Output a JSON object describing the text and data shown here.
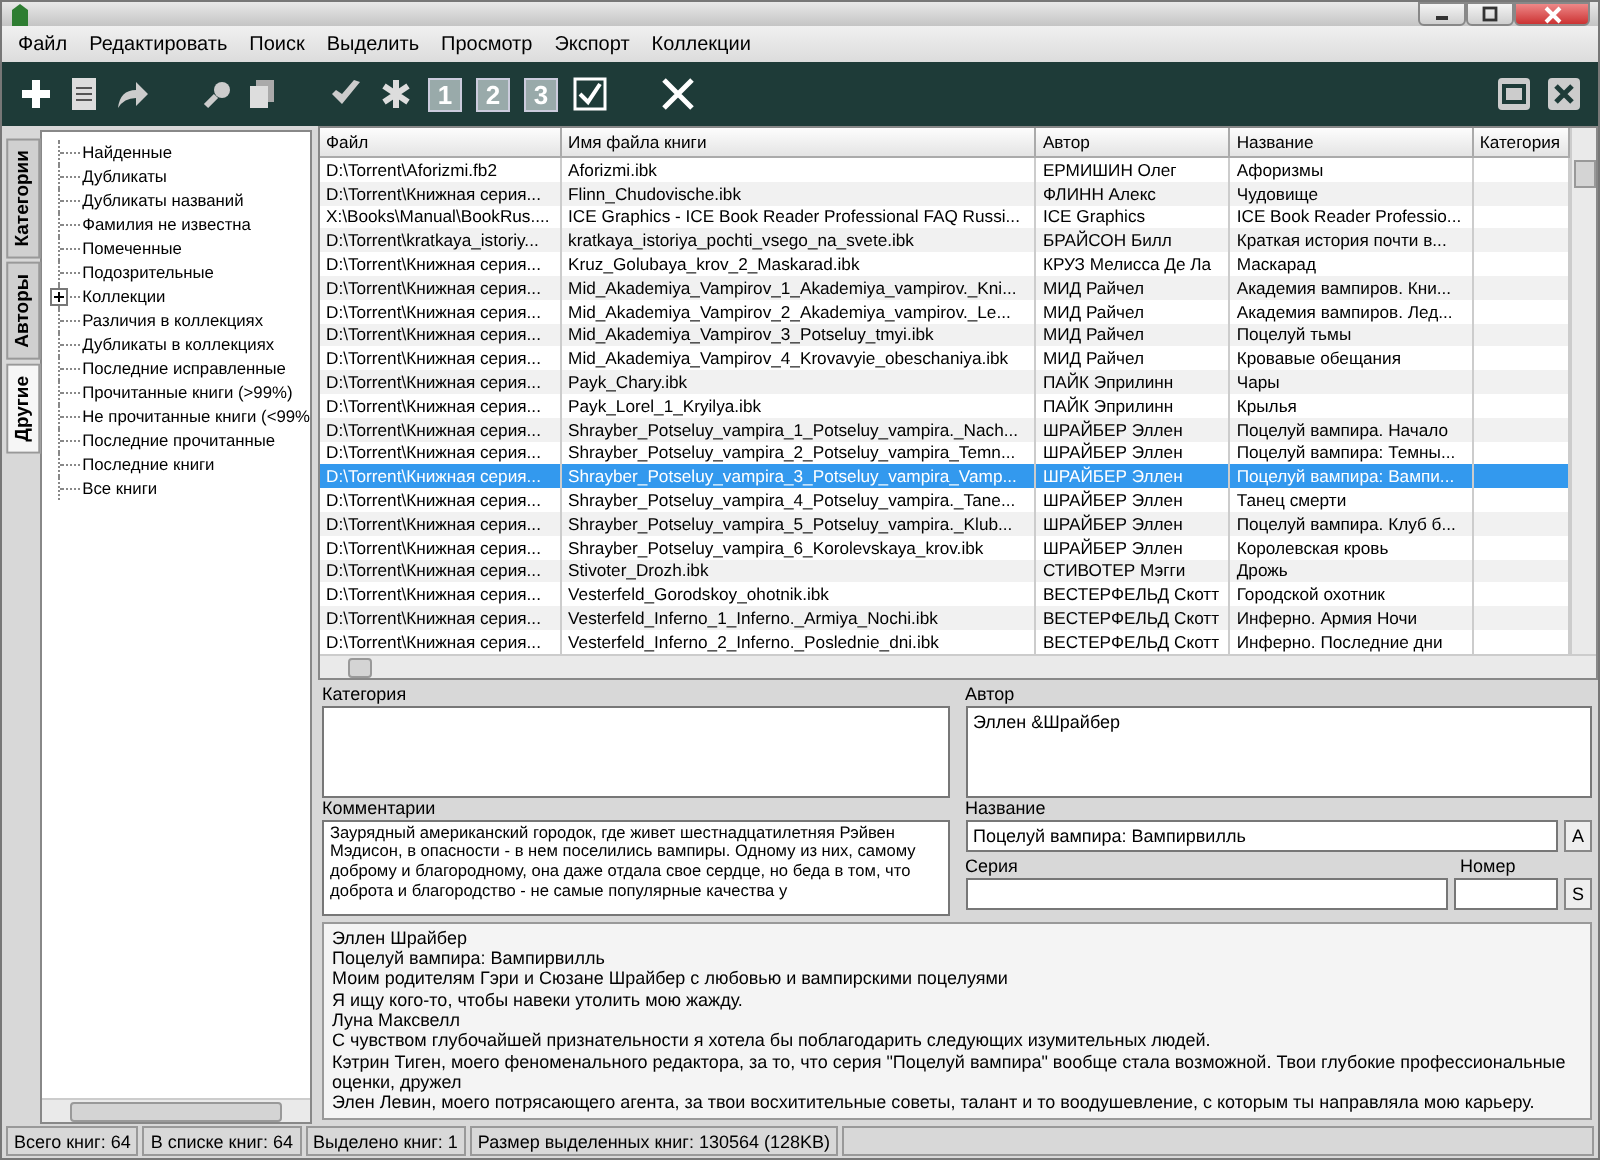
{
  "menu": [
    "Файл",
    "Редактировать",
    "Поиск",
    "Выделить",
    "Просмотр",
    "Экспорт",
    "Коллекции"
  ],
  "toolbar_numbers": [
    "1",
    "2",
    "3"
  ],
  "side_tabs": [
    {
      "label": "Категории",
      "selected": false
    },
    {
      "label": "Авторы",
      "selected": false
    },
    {
      "label": "Другие",
      "selected": true
    }
  ],
  "tree": [
    {
      "label": "Найденные"
    },
    {
      "label": "Дубликаты"
    },
    {
      "label": "Дубликаты названий"
    },
    {
      "label": "Фамилия не известна"
    },
    {
      "label": "Помеченные"
    },
    {
      "label": "Подозрительные"
    },
    {
      "label": "Коллекции",
      "expanded": false
    },
    {
      "label": "Различия в коллекциях"
    },
    {
      "label": "Дубликаты в коллекциях"
    },
    {
      "label": "Последние исправленные"
    },
    {
      "label": "Прочитанные книги (>99%)"
    },
    {
      "label": "Не прочитанные книги (<99%"
    },
    {
      "label": "Последние прочитанные"
    },
    {
      "label": "Последние книги"
    },
    {
      "label": "Все книги"
    }
  ],
  "table": {
    "columns": [
      "Файл",
      "Имя файла книги",
      "Автор",
      "Название",
      "Категория"
    ],
    "rows": [
      {
        "file": "D:\\Torrent\\Aforizmi.fb2",
        "book_file": "Aforizmi.ibk",
        "author": "ЕРМИШИН Олег",
        "title": "Афоризмы",
        "selected": false
      },
      {
        "file": "D:\\Torrent\\Книжная серия...",
        "book_file": "Flinn_Chudovische.ibk",
        "author": "ФЛИНН Алекс",
        "title": "Чудовище",
        "selected": false
      },
      {
        "file": "X:\\Books\\Manual\\BookRus....",
        "book_file": "ICE Graphics - ICE Book Reader Professional FAQ Russi...",
        "author": "ICE Graphics",
        "title": "ICE Book Reader Professio...",
        "selected": false
      },
      {
        "file": "D:\\Torrent\\kratkaya_istoriy...",
        "book_file": "kratkaya_istoriya_pochti_vsego_na_svete.ibk",
        "author": "БРАЙСОН Билл",
        "title": "Краткая история почти в...",
        "selected": false
      },
      {
        "file": "D:\\Torrent\\Книжная серия...",
        "book_file": "Kruz_Golubaya_krov_2_Maskarad.ibk",
        "author": "КРУЗ Мелисса Де Ла",
        "title": "Маскарад",
        "selected": false
      },
      {
        "file": "D:\\Torrent\\Книжная серия...",
        "book_file": "Mid_Akademiya_Vampirov_1_Akademiya_vampirov._Kni...",
        "author": "МИД Райчел",
        "title": "Академия вампиров. Кни...",
        "selected": false
      },
      {
        "file": "D:\\Torrent\\Книжная серия...",
        "book_file": "Mid_Akademiya_Vampirov_2_Akademiya_vampirov._Le...",
        "author": "МИД Райчел",
        "title": "Академия вампиров. Лед...",
        "selected": false
      },
      {
        "file": "D:\\Torrent\\Книжная серия...",
        "book_file": "Mid_Akademiya_Vampirov_3_Potseluy_tmyi.ibk",
        "author": "МИД Райчел",
        "title": "Поцелуй тьмы",
        "selected": false
      },
      {
        "file": "D:\\Torrent\\Книжная серия...",
        "book_file": "Mid_Akademiya_Vampirov_4_Krovavyie_obeschaniya.ibk",
        "author": "МИД Райчел",
        "title": "Кровавые обещания",
        "selected": false
      },
      {
        "file": "D:\\Torrent\\Книжная серия...",
        "book_file": "Payk_Chary.ibk",
        "author": "ПАЙК Эприлинн",
        "title": "Чары",
        "selected": false
      },
      {
        "file": "D:\\Torrent\\Книжная серия...",
        "book_file": "Payk_Lorel_1_Kryilya.ibk",
        "author": "ПАЙК Эприлинн",
        "title": "Крылья",
        "selected": false
      },
      {
        "file": "D:\\Torrent\\Книжная серия...",
        "book_file": "Shrayber_Potseluy_vampira_1_Potseluy_vampira._Nach...",
        "author": "ШРАЙБЕР Эллен",
        "title": "Поцелуй вампира. Начало",
        "selected": false
      },
      {
        "file": "D:\\Torrent\\Книжная серия...",
        "book_file": "Shrayber_Potseluy_vampira_2_Potseluy_vampira_Temn...",
        "author": "ШРАЙБЕР Эллен",
        "title": "Поцелуй вампира: Темны...",
        "selected": false
      },
      {
        "file": "D:\\Torrent\\Книжная серия...",
        "book_file": "Shrayber_Potseluy_vampira_3_Potseluy_vampira_Vamp...",
        "author": "ШРАЙБЕР Эллен",
        "title": "Поцелуй вампира: Вампи...",
        "selected": true
      },
      {
        "file": "D:\\Torrent\\Книжная серия...",
        "book_file": "Shrayber_Potseluy_vampira_4_Potseluy_vampira._Tane...",
        "author": "ШРАЙБЕР Эллен",
        "title": "Танец смерти",
        "selected": false
      },
      {
        "file": "D:\\Torrent\\Книжная серия...",
        "book_file": "Shrayber_Potseluy_vampira_5_Potseluy_vampira._Klub...",
        "author": "ШРАЙБЕР Эллен",
        "title": "Поцелуй вампира. Клуб б...",
        "selected": false
      },
      {
        "file": "D:\\Torrent\\Книжная серия...",
        "book_file": "Shrayber_Potseluy_vampira_6_Korolevskaya_krov.ibk",
        "author": "ШРАЙБЕР Эллен",
        "title": "Королевская кровь",
        "selected": false
      },
      {
        "file": "D:\\Torrent\\Книжная серия...",
        "book_file": "Stivoter_Drozh.ibk",
        "author": "СТИВОТЕР Мэгги",
        "title": "Дрожь",
        "selected": false
      },
      {
        "file": "D:\\Torrent\\Книжная серия...",
        "book_file": "Vesterfeld_Gorodskoy_ohotnik.ibk",
        "author": "ВЕСТЕРФЕЛЬД Скотт",
        "title": "Городской охотник",
        "selected": false
      },
      {
        "file": "D:\\Torrent\\Книжная серия...",
        "book_file": "Vesterfeld_Inferno_1_Inferno._Armiya_Nochi.ibk",
        "author": "ВЕСТЕРФЕЛЬД Скотт",
        "title": "Инферно. Армия Ночи",
        "selected": false
      },
      {
        "file": "D:\\Torrent\\Книжная серия...",
        "book_file": "Vesterfeld_Inferno_2_Inferno._Poslednie_dni.ibk",
        "author": "ВЕСТЕРФЕЛЬД Скотт",
        "title": "Инферно. Последние дни",
        "selected": false
      }
    ]
  },
  "details": {
    "category_label": "Категория",
    "author_label": "Автор",
    "author_value": "Эллен &Шрайбер",
    "comments_label": "Комментарии",
    "comments_value": "Заурядный американский городок, где живет шестнадцатилетняя Рэйвен Мэдисон, в опасности - в нем поселились вампиры. Одному из них, самому доброму и благородному, она даже отдала свое сердце, но беда в том, что доброта и благородство - не самые популярные качества у",
    "title_label": "Название",
    "title_value": "Поцелуй вампира: Вампирвилль",
    "title_button": "A",
    "series_label": "Серия",
    "number_label": "Номер",
    "number_button": "S"
  },
  "text_lines": [
    "Эллен Шрайбер",
    "Поцелуй вампира: Вампирвилль",
    "Моим родителям Гэри и Сюзане Шрайбер с любовью и вампирскими поцелуями",
    "Я ищу кого-то, чтобы навеки утолить мою жажду.",
    "Луна Максвелл",
    "С чувством глубочайшей признательности я хотела бы поблагодарить следующих изумительных людей.",
    "Кэтрин Тиген, моего феноменального редактора, за то, что серия \"Поцелуй вампира\" вообще стала возможной. Твои глубокие профессиональные оценки, дружел",
    "Элен Левин, моего потрясающего агента, за твои восхитительные советы, талант и то воодушевление, с которым ты направляла мою карьеру."
  ],
  "status_bar": [
    "Всего книг: 64",
    "В списке книг: 64",
    "Выделено книг: 1",
    "Размер выделенных книг: 130564  (128KB)"
  ]
}
